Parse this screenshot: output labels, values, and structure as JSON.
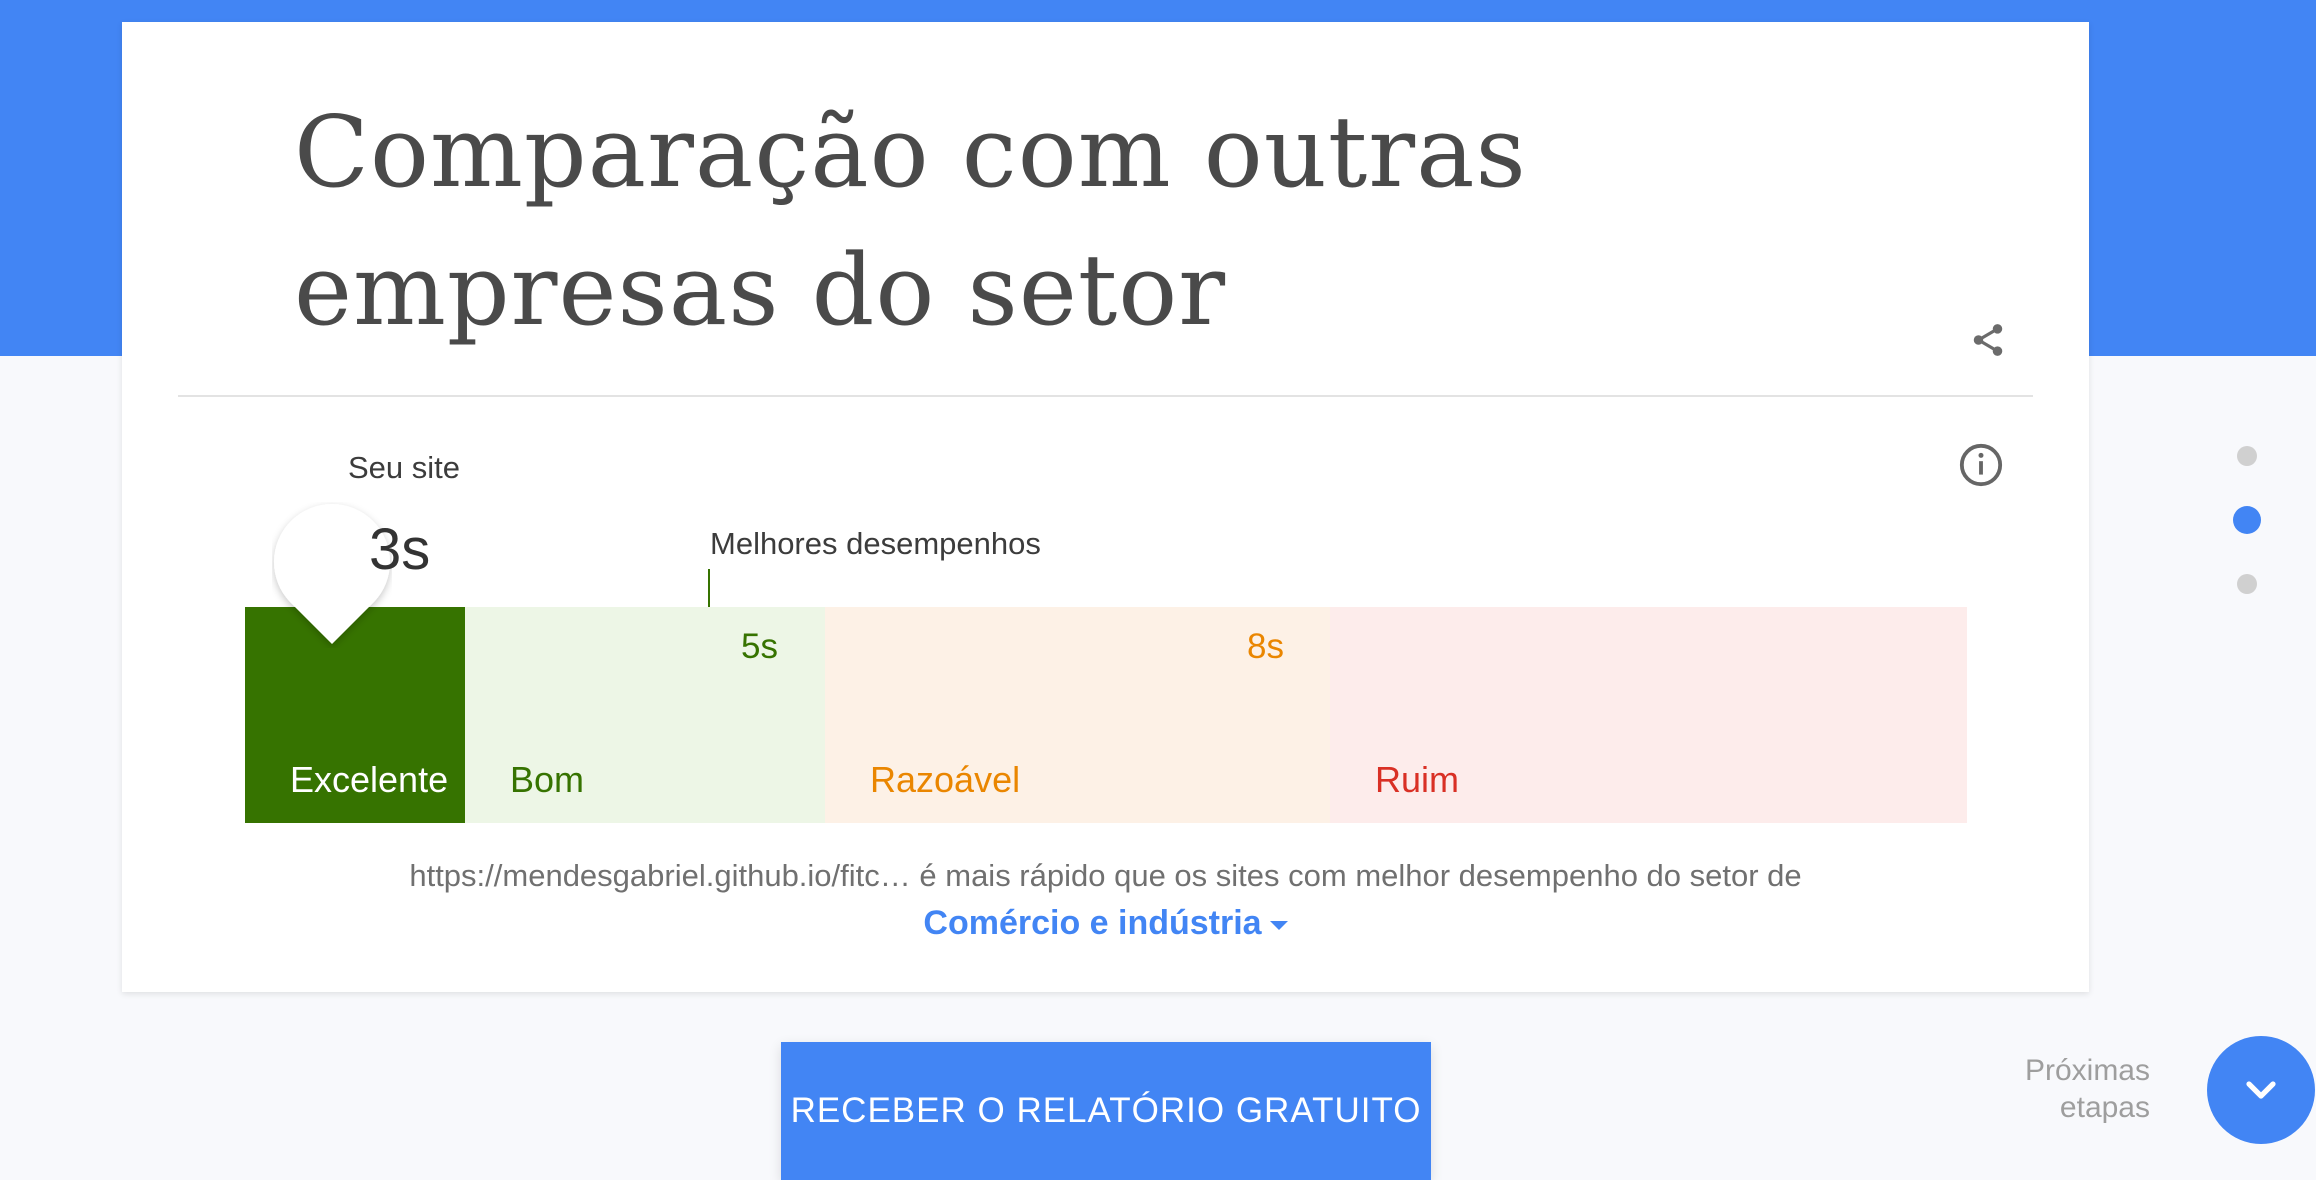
{
  "colors": {
    "brand_blue": "#4285f4",
    "excellent_bg": "#367300",
    "good_bg": "#edf6e6",
    "good_text": "#367300",
    "average_bg": "#fdf1e6",
    "average_text": "#ea8600",
    "poor_bg": "#fdeceb",
    "poor_text": "#d93025",
    "dot_inactive": "#d0d0d0"
  },
  "header": {
    "title_line1": "Comparação com outras",
    "title_line2": "empresas do setor",
    "share_icon": "share-icon"
  },
  "chart": {
    "your_site_label": "Seu site",
    "your_site_value": "3s",
    "best_performers_label": "Melhores desempenhos",
    "info_icon": "info-icon",
    "segments": [
      {
        "label": "Excelente"
      },
      {
        "label": "Bom"
      },
      {
        "label": "Razoável"
      },
      {
        "label": "Ruim"
      }
    ],
    "ticks": [
      "5s",
      "8s"
    ]
  },
  "summary": {
    "url": "https://mendesgabriel.github.io/fitc…",
    "text": " é mais rápido que os sites com melhor desempenho do setor de",
    "industry": "Comércio e indústria"
  },
  "cta": {
    "label": "RECEBER O RELATÓRIO GRATUITO"
  },
  "pager": {
    "active_index": 1,
    "count": 3
  },
  "next_steps": {
    "line1": "Próximas",
    "line2": "etapas",
    "icon": "chevron-down-icon"
  }
}
